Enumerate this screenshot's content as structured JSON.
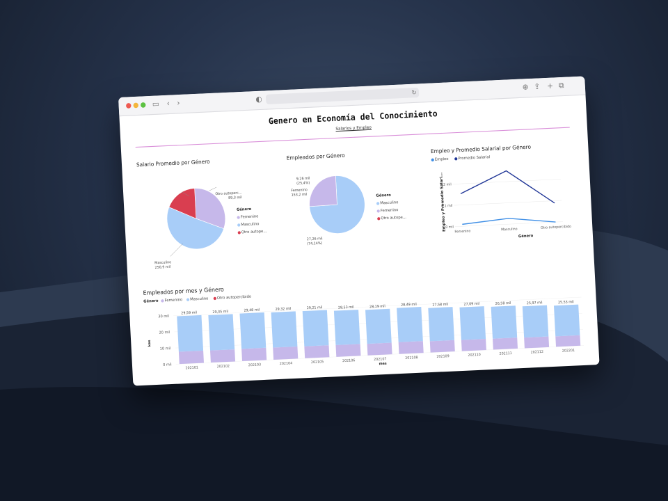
{
  "dashboard": {
    "title": "Genero en Economía del Conocimiento",
    "subtitle": "Salarios y Empleo"
  },
  "colors": {
    "femenino": "#c6b8ea",
    "masculino": "#a8cdf8",
    "otro": "#d93e50",
    "empleo_line": "#3f8fe6",
    "salario_line": "#1f3596"
  },
  "chart_data": [
    {
      "type": "pie",
      "title": "Salario Promedio por Género",
      "legend_title": "Género",
      "legend_position": "right",
      "slices": [
        {
          "label": "Femenino",
          "value": 153.2,
          "display": "153,2 mil"
        },
        {
          "label": "Masculino",
          "value": 250.9,
          "display": "250,9 mil"
        },
        {
          "label": "Otro autopercibido",
          "value": 89.3,
          "display": "89,3 mil"
        }
      ],
      "slice_labels": {
        "femenino": "Femenino",
        "masculino": "Masculino",
        "otro": "Otro autoperc..."
      },
      "legend": [
        "Femenino",
        "Masculino",
        "Otro autope..."
      ]
    },
    {
      "type": "pie",
      "title": "Empleados por Género",
      "legend_title": "Género",
      "legend_position": "right",
      "slices": [
        {
          "label": "Masculino",
          "value": 27.26,
          "display": "27,26 mil",
          "pct": "(74,14%)"
        },
        {
          "label": "Femenino",
          "value": 9.26,
          "display": "9,26 mil",
          "pct": "(25,4%)"
        }
      ],
      "legend": [
        "Masculino",
        "Femenino",
        "Otro autope..."
      ]
    },
    {
      "type": "line",
      "title": "Empleo y Promedio Salarial por Género",
      "categories": [
        "Femenino",
        "Masculino",
        "Otro autopercibido"
      ],
      "category_labels": [
        "Femenino",
        "Masculino",
        "Otro autopercibido"
      ],
      "xlabel": "Género",
      "ylabel": "Empleo y Promedio Salari...",
      "yticks": [
        "0,0 mil",
        "0,1 mil",
        "0,2 mil"
      ],
      "ylim": [
        0,
        0.25
      ],
      "legend_position": "top-left",
      "series": [
        {
          "name": "Empleo",
          "values": [
            0.0093,
            0.0273,
            0.0002
          ]
        },
        {
          "name": "Promedio Salarial",
          "values": [
            0.1532,
            0.2509,
            0.0893
          ]
        }
      ]
    },
    {
      "type": "bar",
      "stacked": true,
      "title": "Empleados por mes y Género",
      "legend_title": "Género",
      "legend": [
        "Femenino",
        "Masculino",
        "Otro autopercibido"
      ],
      "legend_position": "top-left",
      "xlabel": "mes",
      "ylabel": "kes",
      "yticks": [
        "0 mil",
        "10 mil",
        "20 mil",
        "30 mil"
      ],
      "ylim": [
        0,
        32
      ],
      "categories": [
        "202101",
        "202102",
        "202103",
        "202104",
        "202105",
        "202106",
        "202107",
        "202108",
        "202109",
        "202110",
        "202111",
        "202112",
        "202201"
      ],
      "totals": [
        29.59,
        29.35,
        29.48,
        29.32,
        29.21,
        28.53,
        28.19,
        28.49,
        27.58,
        27.09,
        26.58,
        25.97,
        25.53
      ],
      "total_labels": [
        "29,59 mil",
        "29,35 mil",
        "29,48 mil",
        "29,32 mil",
        "29,21 mil",
        "28,53 mil",
        "28,19 mil",
        "28,49 mil",
        "27,58 mil",
        "27,09 mil",
        "26,58 mil",
        "25,97 mil",
        "25,53 mil"
      ],
      "series": [
        {
          "name": "Femenino",
          "values": [
            7.6,
            7.5,
            7.6,
            7.5,
            7.4,
            7.3,
            7.2,
            7.3,
            7.0,
            6.9,
            6.8,
            6.6,
            6.5
          ]
        },
        {
          "name": "Masculino",
          "values": [
            21.99,
            21.85,
            21.88,
            21.82,
            21.81,
            21.23,
            20.99,
            21.19,
            20.58,
            20.19,
            19.78,
            19.37,
            19.03
          ]
        },
        {
          "name": "Otro autopercibido",
          "values": [
            0,
            0,
            0,
            0,
            0,
            0,
            0,
            0,
            0,
            0,
            0,
            0,
            0
          ]
        }
      ]
    }
  ]
}
